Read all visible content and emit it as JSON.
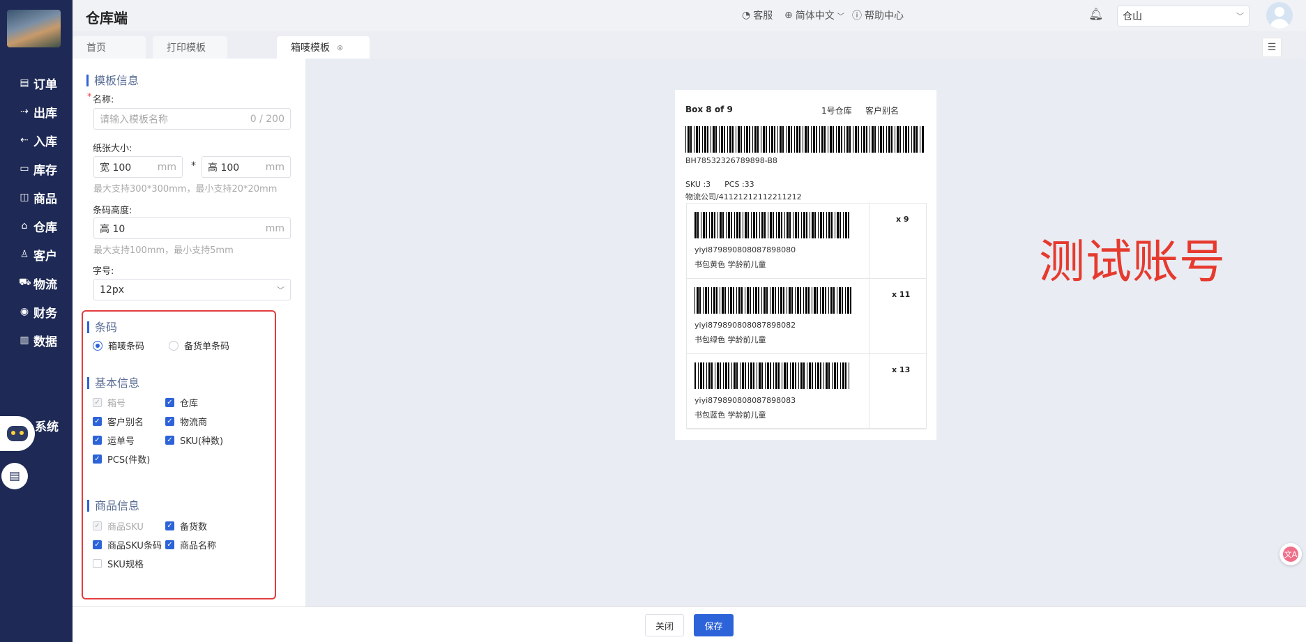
{
  "sidebar": {
    "items": [
      {
        "icon": "receipt-icon",
        "label": "订单"
      },
      {
        "icon": "export-icon",
        "label": "出库"
      },
      {
        "icon": "import-icon",
        "label": "入库"
      },
      {
        "icon": "archive-icon",
        "label": "库存"
      },
      {
        "icon": "shopping-bag-icon",
        "label": "商品"
      },
      {
        "icon": "home-icon",
        "label": "仓库"
      },
      {
        "icon": "user-icon",
        "label": "客户"
      },
      {
        "icon": "truck-icon",
        "label": "物流"
      },
      {
        "icon": "finance-icon",
        "label": "财务"
      },
      {
        "icon": "bar-chart-icon",
        "label": "数据"
      }
    ],
    "system_label": "系统"
  },
  "header": {
    "app_title": "仓库端",
    "service": "客服",
    "language": "简体中文",
    "help": "帮助中心",
    "warehouse": "仓山"
  },
  "tabs": [
    "首页",
    "打印模板",
    "箱唛模板"
  ],
  "form": {
    "template_info_title": "模板信息",
    "name_label": "名称:",
    "name_placeholder": "请输入模板名称",
    "name_count": "0 / 200",
    "paper_label": "纸张大小:",
    "width_prefix": "宽",
    "width_value": "100",
    "height_prefix": "高",
    "height_value": "100",
    "unit": "mm",
    "times": "*",
    "paper_hint": "最大支持300*300mm，最小支持20*20mm",
    "barcode_height_label": "条码高度:",
    "barcode_height_value": "10",
    "barcode_height_hint": "最大支持100mm，最小支持5mm",
    "font_label": "字号:",
    "font_value": "12px",
    "barcode_section": "条码",
    "barcode_options": [
      "箱唛条码",
      "备货单条码"
    ],
    "barcode_selected": "箱唛条码",
    "basic_section": "基本信息",
    "basic_fields": [
      {
        "label": "箱号",
        "checked": true,
        "disabled": true
      },
      {
        "label": "仓库",
        "checked": true,
        "disabled": false
      },
      {
        "label": "客户别名",
        "checked": true,
        "disabled": false
      },
      {
        "label": "物流商",
        "checked": true,
        "disabled": false
      },
      {
        "label": "运单号",
        "checked": true,
        "disabled": false
      },
      {
        "label": "SKU(种数)",
        "checked": true,
        "disabled": false
      },
      {
        "label": "PCS(件数)",
        "checked": true,
        "disabled": false
      }
    ],
    "product_section": "商品信息",
    "product_fields": [
      {
        "label": "商品SKU",
        "checked": true,
        "disabled": true
      },
      {
        "label": "备货数",
        "checked": true,
        "disabled": false
      },
      {
        "label": "商品SKU条码",
        "checked": true,
        "disabled": false
      },
      {
        "label": "商品名称",
        "checked": true,
        "disabled": false
      },
      {
        "label": "SKU规格",
        "checked": false,
        "disabled": false
      }
    ]
  },
  "label_preview": {
    "box_title": "Box 8 of 9",
    "warehouse": "1号仓库",
    "customer_alias": "客户别名",
    "barcode_number": "BH78532326789898-B8",
    "sku": "SKU :3",
    "pcs": "PCS :33",
    "carrier": "物流公司/41121212112211212",
    "items": [
      {
        "code": "yiyi879890808087898080",
        "name": "书包黄色 学龄前儿童",
        "qty": "x 9"
      },
      {
        "code": "yiyi879890808087898082",
        "name": "书包绿色 学龄前儿童",
        "qty": "x 11"
      },
      {
        "code": "yiyi879890808087898083",
        "name": "书包蓝色 学龄前儿童",
        "qty": "x 13"
      }
    ]
  },
  "watermark": "测试账号",
  "footer": {
    "close": "关闭",
    "save": "保存"
  },
  "colors": {
    "sidebar": "#1e2a55",
    "primary": "#2d63d8",
    "highlight_border": "#e13d3d",
    "watermark": "#e63a2e"
  }
}
